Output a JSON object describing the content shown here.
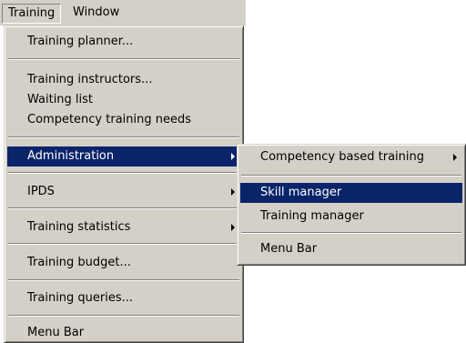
{
  "menubar": {
    "training_label": "Training",
    "window_label": "Window"
  },
  "training_menu": {
    "items": [
      "Training planner...",
      "Training instructors...",
      "Waiting list",
      "Competency training needs",
      "Administration",
      "IPDS",
      "Training statistics",
      "Training budget...",
      "Training queries...",
      "Menu Bar"
    ]
  },
  "admin_submenu": {
    "items": [
      "Competency based training",
      "Skill manager",
      "Training manager",
      "Menu Bar"
    ]
  },
  "colors": {
    "menu_face": "#d4d0c8",
    "highlight": "#0a246a",
    "highlight_text": "#ffffff"
  }
}
